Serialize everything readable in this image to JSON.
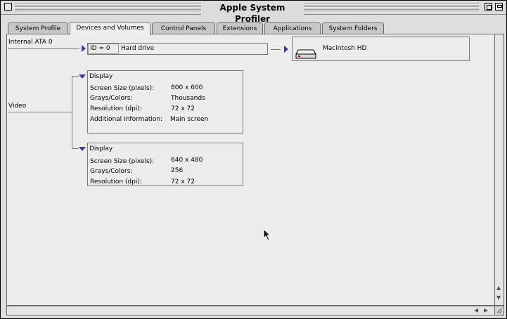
{
  "window": {
    "title": "Apple System Profiler"
  },
  "tabs": [
    {
      "label": "System Profile"
    },
    {
      "label": "Devices and Volumes",
      "active": true
    },
    {
      "label": "Control Panels"
    },
    {
      "label": "Extensions"
    },
    {
      "label": "Applications"
    },
    {
      "label": "System Folders"
    }
  ],
  "bus": {
    "label": "Internal ATA 0",
    "device_id": "ID = 0",
    "device_name": "Hard drive",
    "volume_name": "Macintosh HD"
  },
  "video": {
    "label": "Video",
    "displays": [
      {
        "title": "Display",
        "rows": [
          {
            "key": "Screen Size (pixels):",
            "value": "800 x 600"
          },
          {
            "key": "Grays/Colors:",
            "value": "Thousands"
          },
          {
            "key": "Resolution (dpi):",
            "value": "72 x 72"
          },
          {
            "key": "Additional Information:",
            "value": "Main screen"
          }
        ]
      },
      {
        "title": "Display",
        "rows": [
          {
            "key": "Screen Size (pixels):",
            "value": "640 x 480"
          },
          {
            "key": "Grays/Colors:",
            "value": "256"
          },
          {
            "key": "Resolution (dpi):",
            "value": "72 x 72"
          }
        ]
      }
    ]
  }
}
